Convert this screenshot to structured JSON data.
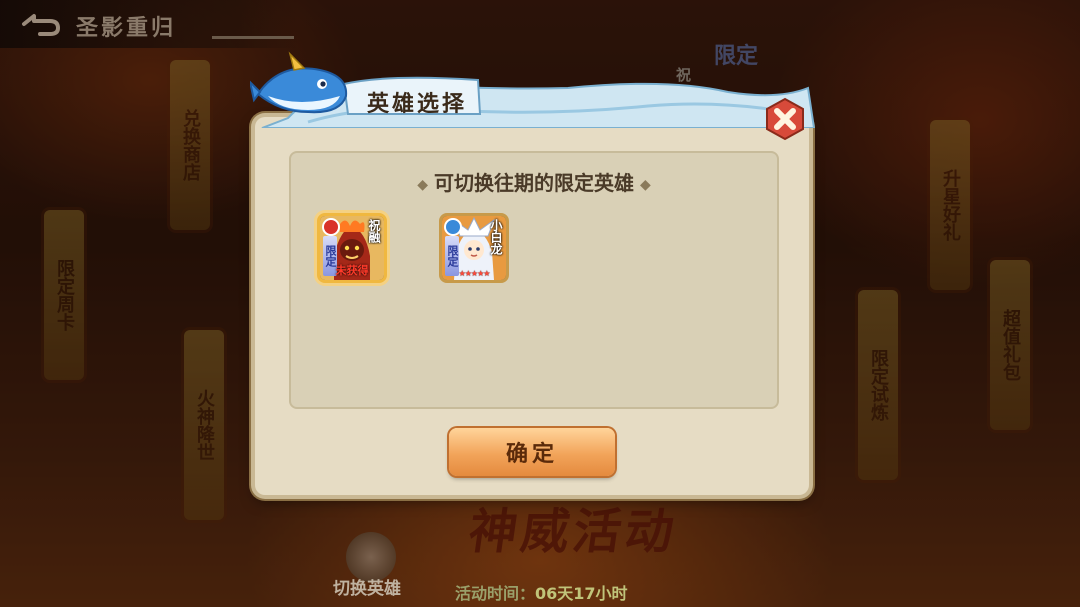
{
  "topbar": {
    "title": "圣影重归"
  },
  "background": {
    "banners": [
      "兑换商店",
      "限定周卡",
      "火神降世",
      "升星好礼",
      "限定试炼",
      "超值礼包"
    ],
    "limited_tag": "限定",
    "zhu_tag": "祝",
    "event_title": "神威活动",
    "switch_hero_label": "切换英雄",
    "event_time_label": "活动时间：",
    "event_time_value": "06天17小时"
  },
  "dialog": {
    "header_title": "英雄选择",
    "panel_title": "可切换往期的限定英雄",
    "heroes": [
      {
        "name": "祝融",
        "limited_label": "限定",
        "bottom_label": "未获得",
        "selected": true,
        "element_icon": "fire-element-icon",
        "accent": "#d9322a"
      },
      {
        "name": "小白龙",
        "limited_label": "限定",
        "stars": "★★★★★",
        "selected": false,
        "element_icon": "water-element-icon",
        "accent": "#3a8ad9"
      }
    ],
    "confirm_label": "确定"
  },
  "colors": {
    "panel": "#e6dcc4",
    "button": "#f2a45a",
    "close": "#d84a3a"
  }
}
